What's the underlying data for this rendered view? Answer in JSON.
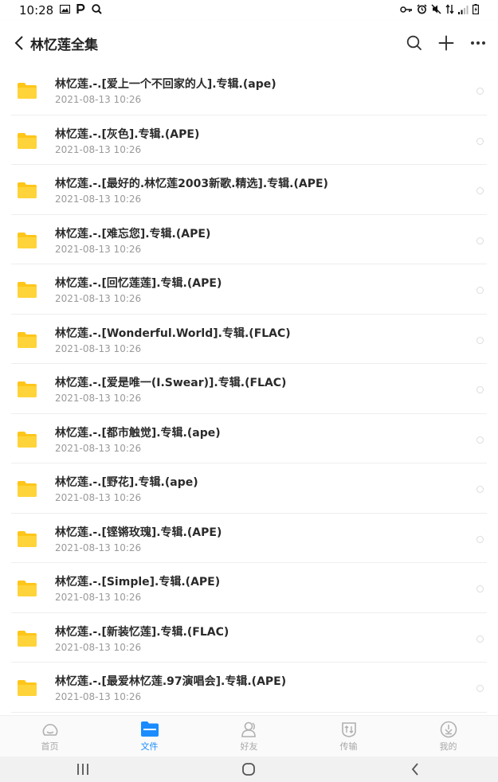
{
  "status_bar": {
    "time": "10:28",
    "left_icons": [
      "image-icon",
      "p-icon",
      "search-icon"
    ],
    "right_icons": [
      "key-icon",
      "alarm-icon",
      "mute-icon",
      "data-icon",
      "signal-icon",
      "battery-icon"
    ]
  },
  "header": {
    "title": "林忆莲全集",
    "actions": [
      "search-icon",
      "add-icon",
      "more-icon"
    ]
  },
  "files": [
    {
      "name": "林忆莲.-.[爱上一个不回家的人].专辑.(ape)",
      "date": "2021-08-13  10:26"
    },
    {
      "name": "林忆莲.-.[灰色].专辑.(APE)",
      "date": "2021-08-13  10:26"
    },
    {
      "name": "林忆莲.-.[最好的.林忆莲2003新歌.精选].专辑.(APE)",
      "date": "2021-08-13  10:26"
    },
    {
      "name": "林忆莲.-.[难忘您].专辑.(APE)",
      "date": "2021-08-13  10:26"
    },
    {
      "name": "林忆莲.-.[回忆莲莲].专辑.(APE)",
      "date": "2021-08-13  10:26"
    },
    {
      "name": "林忆莲.-.[Wonderful.World].专辑.(FLAC)",
      "date": "2021-08-13  10:26"
    },
    {
      "name": "林忆莲.-.[爱是唯一(I.Swear)].专辑.(FLAC)",
      "date": "2021-08-13  10:26"
    },
    {
      "name": "林忆莲.-.[都市触觉].专辑.(ape)",
      "date": "2021-08-13  10:26"
    },
    {
      "name": "林忆莲.-.[野花].专辑.(ape)",
      "date": "2021-08-13  10:26"
    },
    {
      "name": "林忆莲.-.[铿锵玫瑰].专辑.(APE)",
      "date": "2021-08-13  10:26"
    },
    {
      "name": "林忆莲.-.[Simple].专辑.(APE)",
      "date": "2021-08-13  10:26"
    },
    {
      "name": "林忆莲.-.[新装忆莲].专辑.(FLAC)",
      "date": "2021-08-13  10:26"
    },
    {
      "name": "林忆莲.-.[最爱林忆莲.97演唱会].专辑.(APE)",
      "date": "2021-08-13  10:26"
    }
  ],
  "bottom_nav": [
    {
      "label": "首页",
      "icon": "home-icon",
      "active": false
    },
    {
      "label": "文件",
      "icon": "folder-icon",
      "active": true
    },
    {
      "label": "好友",
      "icon": "friends-icon",
      "active": false
    },
    {
      "label": "传输",
      "icon": "transfer-icon",
      "active": false
    },
    {
      "label": "我的",
      "icon": "profile-icon",
      "active": false
    }
  ],
  "colors": {
    "accent": "#1a8cff",
    "folder": "#ffc61a",
    "inactive": "#a8a8a8"
  }
}
